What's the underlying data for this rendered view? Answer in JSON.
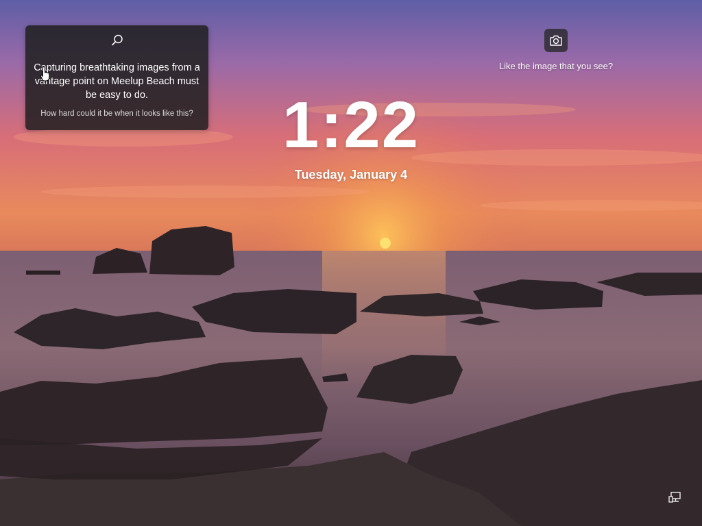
{
  "lockscreen": {
    "spotlight": {
      "headline": "Capturing breathtaking images from a vantage point on Meelup Beach must be easy to do.",
      "subtext": "How hard could it be when it looks like this?",
      "search_icon": "search-icon"
    },
    "feedback": {
      "camera_icon": "camera-icon",
      "label": "Like the image that you see?"
    },
    "time": "1:22",
    "date": "Tuesday, January 4",
    "status_icon": "network-icon"
  },
  "colors": {
    "sky_top": "#6b5aa0",
    "sky_mid": "#d06a6a",
    "horizon": "#f0a050",
    "sun": "#ffd060",
    "sea": "#7a5a6a",
    "rock": "#2e2628"
  }
}
